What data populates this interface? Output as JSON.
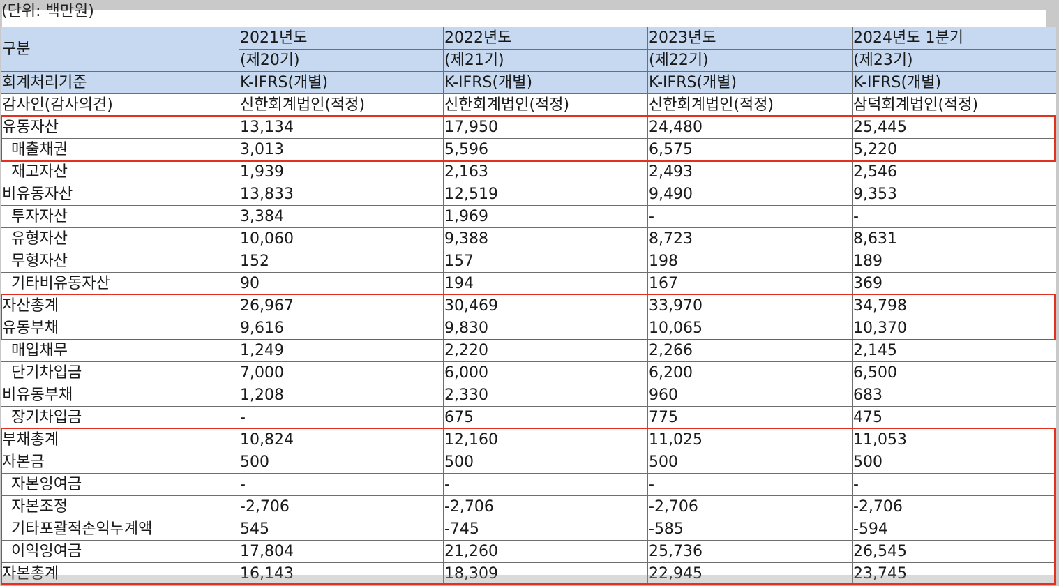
{
  "unit": "(단위: 백만원)",
  "header": {
    "category": "구분",
    "years": [
      "2021년도",
      "2022년도",
      "2023년도",
      "2024년도 1분기"
    ],
    "terms": [
      "(제20기)",
      "(제21기)",
      "(제22기)",
      "(제23기)"
    ]
  },
  "info_rows": [
    {
      "label": "회계처리기준",
      "values": [
        "K-IFRS(개별)",
        "K-IFRS(개별)",
        "K-IFRS(개별)",
        "K-IFRS(개별)"
      ]
    },
    {
      "label": "감사인(감사의견)",
      "values": [
        "신한회계법인(적정)",
        "신한회계법인(적정)",
        "신한회계법인(적정)",
        "삼덕회계법인(적정)"
      ]
    }
  ],
  "rows": [
    {
      "label": "유동자산",
      "sub": false,
      "values": [
        "13,134",
        "17,950",
        "24,480",
        "25,445"
      ]
    },
    {
      "label": "매출채권",
      "sub": true,
      "values": [
        "3,013",
        "5,596",
        "6,575",
        "5,220"
      ]
    },
    {
      "label": "재고자산",
      "sub": true,
      "values": [
        "1,939",
        "2,163",
        "2,493",
        "2,546"
      ]
    },
    {
      "label": "비유동자산",
      "sub": false,
      "values": [
        "13,833",
        "12,519",
        "9,490",
        "9,353"
      ]
    },
    {
      "label": "투자자산",
      "sub": true,
      "values": [
        "3,384",
        "1,969",
        "-",
        "-"
      ]
    },
    {
      "label": "유형자산",
      "sub": true,
      "values": [
        "10,060",
        "9,388",
        "8,723",
        "8,631"
      ]
    },
    {
      "label": "무형자산",
      "sub": true,
      "values": [
        "152",
        "157",
        "198",
        "189"
      ]
    },
    {
      "label": "기타비유동자산",
      "sub": true,
      "values": [
        "90",
        "194",
        "167",
        "369"
      ]
    },
    {
      "label": "자산총계",
      "sub": false,
      "values": [
        "26,967",
        "30,469",
        "33,970",
        "34,798"
      ]
    },
    {
      "label": "유동부채",
      "sub": false,
      "values": [
        "9,616",
        "9,830",
        "10,065",
        "10,370"
      ]
    },
    {
      "label": "매입채무",
      "sub": true,
      "values": [
        "1,249",
        "2,220",
        "2,266",
        "2,145"
      ]
    },
    {
      "label": "단기차입금",
      "sub": true,
      "values": [
        "7,000",
        "6,000",
        "6,200",
        "6,500"
      ]
    },
    {
      "label": "비유동부채",
      "sub": false,
      "values": [
        "1,208",
        "2,330",
        "960",
        "683"
      ]
    },
    {
      "label": "장기차입금",
      "sub": true,
      "values": [
        "-",
        "675",
        "775",
        "475"
      ]
    },
    {
      "label": "부채총계",
      "sub": false,
      "values": [
        "10,824",
        "12,160",
        "11,025",
        "11,053"
      ]
    },
    {
      "label": "자본금",
      "sub": false,
      "values": [
        "500",
        "500",
        "500",
        "500"
      ]
    },
    {
      "label": "자본잉여금",
      "sub": true,
      "values": [
        "-",
        "-",
        "-",
        "-"
      ]
    },
    {
      "label": "자본조정",
      "sub": true,
      "values": [
        "-2,706",
        "-2,706",
        "-2,706",
        "-2,706"
      ]
    },
    {
      "label": "기타포괄적손익누계액",
      "sub": true,
      "values": [
        "545",
        "-745",
        "-585",
        "-594"
      ]
    },
    {
      "label": "이익잉여금",
      "sub": true,
      "values": [
        "17,804",
        "21,260",
        "25,736",
        "26,545"
      ]
    },
    {
      "label": "자본총계",
      "sub": false,
      "values": [
        "16,143",
        "18,309",
        "22,945",
        "23,745"
      ]
    }
  ],
  "highlight_color": "#e0321e",
  "header_color": "#c6d9f1"
}
